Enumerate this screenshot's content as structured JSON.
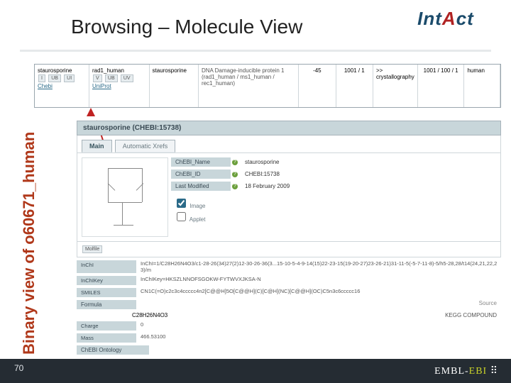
{
  "title": "Browsing – Molecule View",
  "logo": {
    "text": "Int Act"
  },
  "sidebar_label": "Binary view of o60671_human",
  "page_number": "70",
  "footer_brand": "EMBL-EBI",
  "binary_row": {
    "col1_label": "staurosporine",
    "chips1": [
      "I",
      "UB",
      "UI"
    ],
    "link1": "Chebi",
    "col2_head": "rad1_human",
    "chips2": [
      "V",
      "UB",
      "UV"
    ],
    "link2": "UniProt",
    "col3_top": "staurosporine",
    "col4_text": "DNA Damage-inducible protein 1 (rad1_human / ms1_human / rec1_human)",
    "col5": "-45",
    "col6": "1001 / 1",
    "col7": ">> crystallography",
    "col8": "1001 / 100 / 1",
    "col9": "human"
  },
  "chebi": {
    "title": "staurosporine (CHEBI:15738)",
    "tab_main": "Main",
    "tab_axrefs": "Automatic Xrefs",
    "name_label": "ChEBI_Name",
    "name_value": "staurosporine",
    "id_label": "ChEBI_ID",
    "id_value": "CHEBI:15738",
    "modified_label": "Last Modified",
    "modified_value": "18 February 2009",
    "toggle_image": "Image",
    "toggle_applet": "Applet",
    "molfile_label": "Molfile",
    "inchi_label": "InChI",
    "inchi_value": "InChI=1/C28H26N4O3/c1-28-26(34)27(2)12-30-26-36(3...15-10-5-4-9-14(15)22-23-15(19-20-27)23-26-21)31-11-5(-5-7-11-8)-5/h5-28,28/t14(24,21,22,23)/m",
    "inchikey_label": "InChIKey",
    "inchikey_value": "InChIKey=HKSZLNNOFSGOKW-FYTWVXJKSA-N",
    "smiles_label": "SMILES",
    "smiles_value": "CN1C(=O)c2c3c4ccccc4n2[C@@H]5O[C@@H](C)[C@H](NC)[C@@H](OC)C5n3c6ccccc16",
    "formula_label": "Formula",
    "formula_value": "C28H26N4O3",
    "source_col_label": "Source",
    "source_value": "KEGG COMPOUND",
    "charge_label": "Charge",
    "charge_value": "0",
    "mass_label": "Mass",
    "mass_value": "466.53100",
    "ontology_label": "ChEBI Ontology"
  }
}
